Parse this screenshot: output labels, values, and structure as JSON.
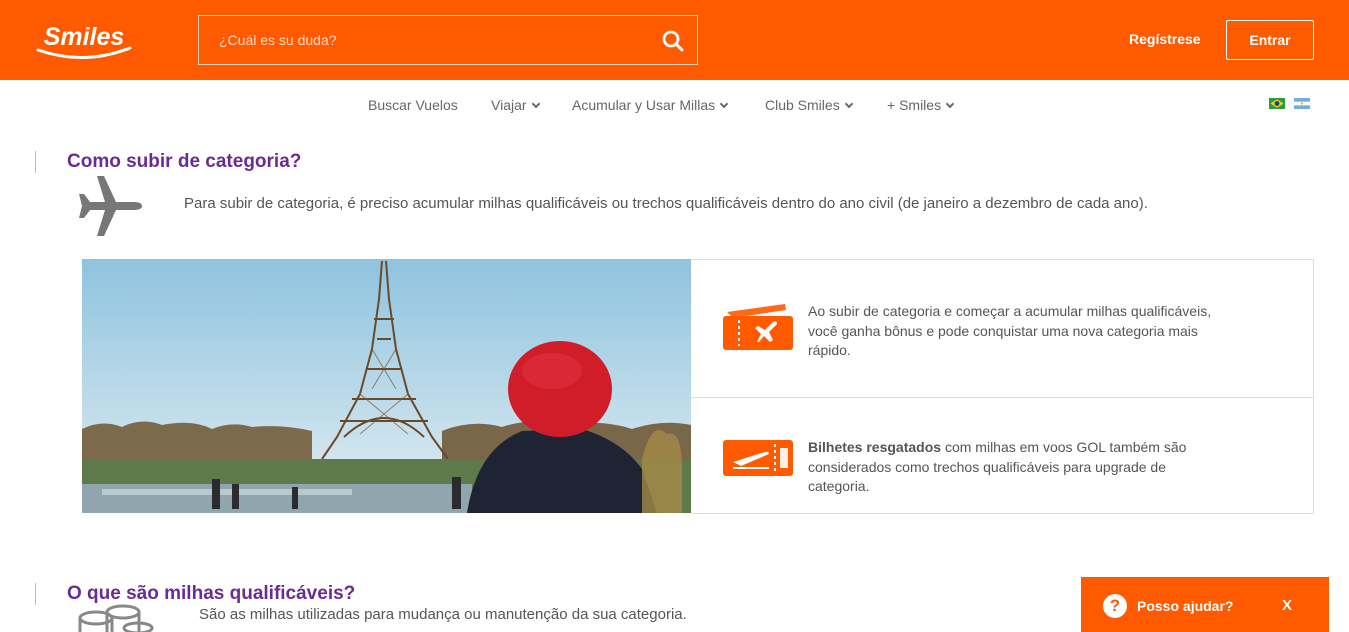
{
  "header": {
    "logo_text": "Smiles",
    "search_placeholder": "¿Cuál es su duda?",
    "register_label": "Regístrese",
    "login_label": "Entrar"
  },
  "nav": {
    "items": [
      {
        "label": "Buscar Vuelos",
        "dropdown": false
      },
      {
        "label": "Viajar",
        "dropdown": true
      },
      {
        "label": "Acumular y Usar Millas",
        "dropdown": true
      },
      {
        "label": "Club Smiles",
        "dropdown": true
      },
      {
        "label": "+ Smiles",
        "dropdown": true
      }
    ],
    "languages": [
      "brazil-flag-icon",
      "argentina-flag-icon"
    ]
  },
  "section1": {
    "title": "Como subir de categoria?",
    "icon": "airplane-icon",
    "intro": "Para subir de categoria, é preciso acumular milhas qualificáveis ou trechos qualificáveis dentro do ano civil (de janeiro a dezembro de cada ano).",
    "photo_icon": "eiffel-tower-photo",
    "info": [
      {
        "icon": "ticket-airplane-icon",
        "lines": [
          "Ao subir de categoria e começar a acumular milhas qualificáveis,",
          "você ganha bônus e pode conquistar uma nova categoria mais",
          "rápido."
        ]
      },
      {
        "icon": "boarding-pass-icon",
        "bold": "Bilhetes resgatados",
        "line1_rest": " com milhas em voos GOL também são",
        "lines": [
          "considerados como trechos qualificáveis para upgrade de",
          "categoria."
        ]
      }
    ]
  },
  "section2": {
    "title": "O que são milhas qualificáveis?",
    "icon": "coins-stack-icon",
    "text": "São as milhas utilizadas para mudança ou manutenção da sua categoria."
  },
  "help_widget": {
    "label": "Posso ajudar?",
    "icon_glyph": "?",
    "close_label": "X"
  },
  "colors": {
    "brand_orange": "#ff5a00",
    "title_purple": "#6b2c91"
  }
}
